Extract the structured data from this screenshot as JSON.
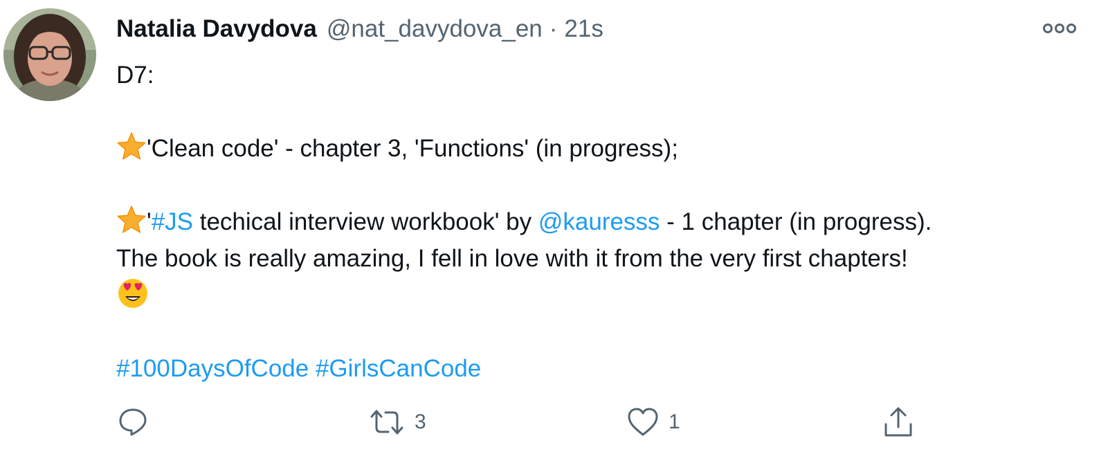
{
  "tweet": {
    "author": {
      "display_name": "Natalia Davydova",
      "handle": "@nat_davydova_en",
      "separator": "·",
      "timestamp": "21s"
    },
    "body": {
      "line1": "D7:",
      "item1": {
        "emoji": "star-emoji",
        "text": "'Clean code' - chapter 3, 'Functions' (in progress);"
      },
      "item2": {
        "emoji": "star-emoji",
        "quote_open": "'",
        "hashtag": "#JS",
        "text_a": " techical interview workbook' by ",
        "mention": "@kauresss",
        "text_b": " - 1 chapter (in progress)."
      },
      "sentence": "The book is really amazing, I fell in love with it from the very first chapters!",
      "end_emoji": "heart-eyes-emoji",
      "hashtags": [
        "#100DaysOfCode",
        "#GirlsCanCode"
      ]
    },
    "actions": {
      "reply_count": "",
      "retweet_count": "3",
      "like_count": "1"
    },
    "icons": {
      "more": "more-horizontal-icon",
      "reply": "reply-icon",
      "retweet": "retweet-icon",
      "like": "heart-icon",
      "share": "share-icon"
    },
    "colors": {
      "text": "#0f1419",
      "secondary": "#536471",
      "link": "#1d9bf0",
      "star": "#f9ae2d"
    }
  }
}
